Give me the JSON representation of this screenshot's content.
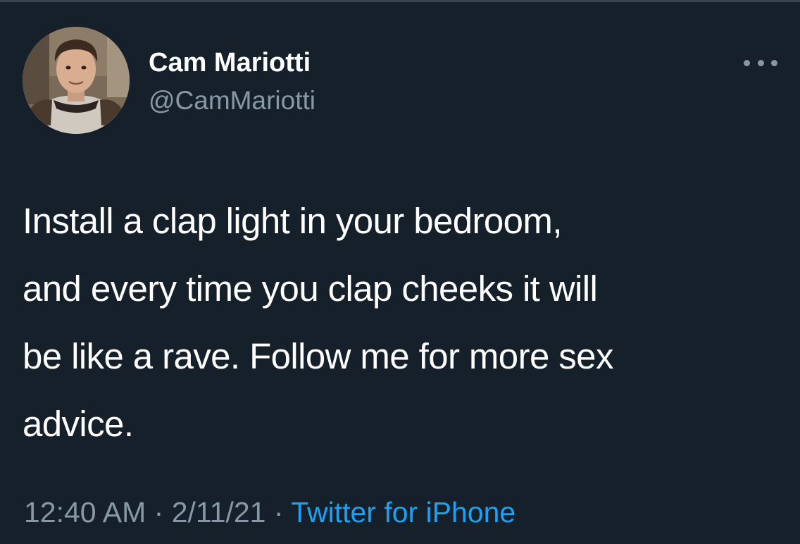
{
  "user": {
    "display_name": "Cam Mariotti",
    "handle": "@CamMariotti"
  },
  "more_icon": "ellipsis-icon",
  "tweet": {
    "lines": [
      "Install a clap light in your bedroom,",
      "and every time you clap cheeks it will",
      "be like a rave. Follow me for more sex",
      "advice."
    ]
  },
  "meta": {
    "time": "12:40 AM",
    "separator": "·",
    "date": "2/11/21",
    "source": "Twitter for iPhone"
  },
  "colors": {
    "background": "#15202b",
    "text": "#ffffff",
    "secondary": "#8899a6",
    "link": "#1da1f2"
  }
}
